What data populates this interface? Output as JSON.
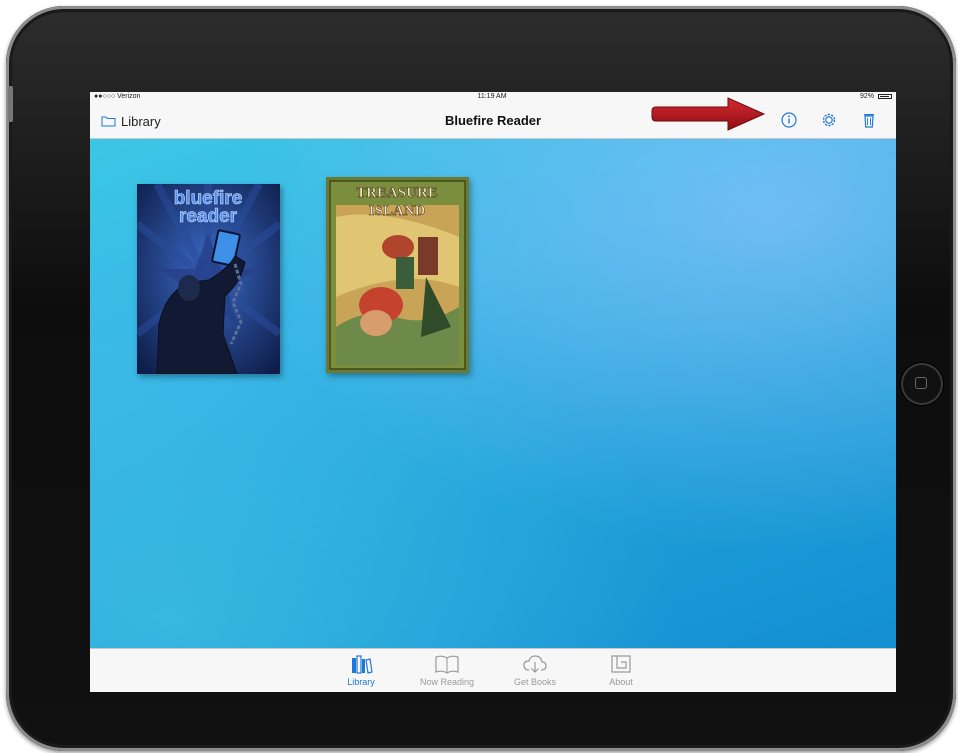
{
  "status_bar": {
    "carrier": "●●○○○ Verizon",
    "time": "11:19 AM",
    "battery": "92%"
  },
  "nav_bar": {
    "back_label": "Library",
    "title": "Bluefire Reader",
    "icons": [
      "info-icon",
      "gear-icon",
      "trash-icon"
    ]
  },
  "books": [
    {
      "title_line_1": "bluefire",
      "title_line_2": "reader"
    },
    {
      "title_line_1": "TREASURE",
      "title_line_2": "ISLAND"
    }
  ],
  "tab_bar": {
    "tabs": [
      {
        "label": "Library",
        "icon": "library-icon",
        "active": true
      },
      {
        "label": "Now Reading",
        "icon": "open-book-icon",
        "active": false
      },
      {
        "label": "Get Books",
        "icon": "download-cloud-icon",
        "active": false
      },
      {
        "label": "About",
        "icon": "about-icon",
        "active": false
      }
    ]
  },
  "colors": {
    "accent": "#1f78d6",
    "arrow": "#b5121b",
    "background_top": "#3bc7e5",
    "background_bottom": "#138fd2"
  }
}
